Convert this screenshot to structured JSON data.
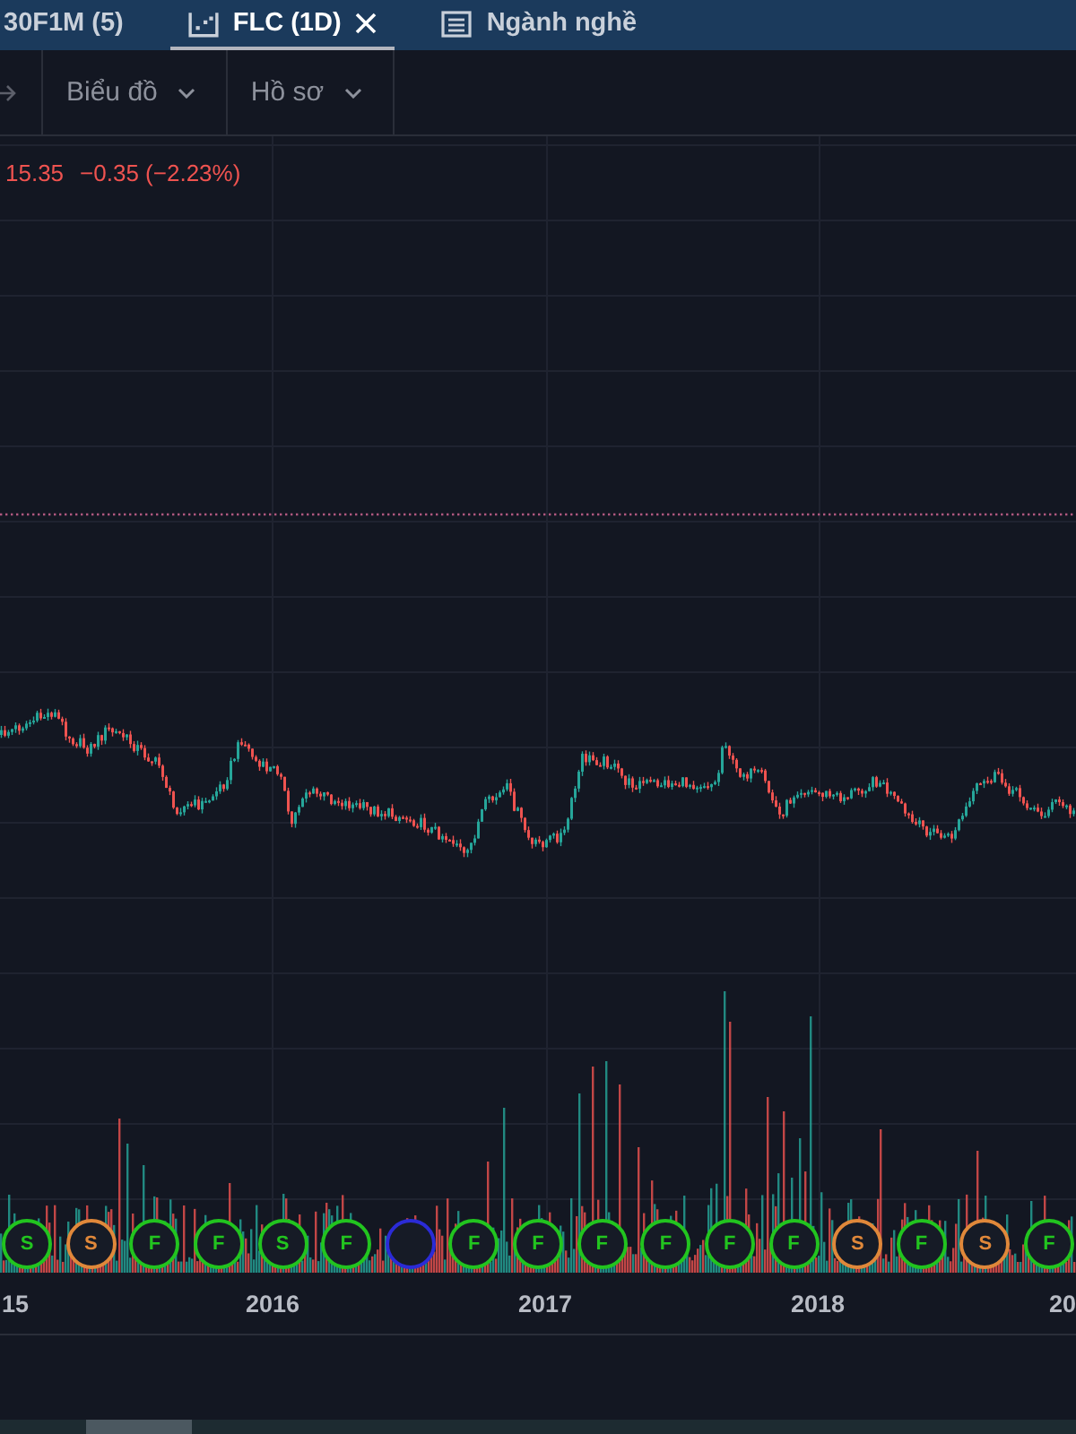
{
  "tabs": [
    {
      "kind": "symbol",
      "label": "30F1M (5)",
      "selected": false
    },
    {
      "kind": "chart",
      "label": "FLC (1D)",
      "selected": true
    },
    {
      "kind": "table",
      "label": "Ngành nghề",
      "selected": false
    }
  ],
  "toolbar": {
    "menus": [
      {
        "label": "Biểu đồ"
      },
      {
        "label": "Hồ sơ"
      }
    ]
  },
  "chart": {
    "legend": {
      "close": "15.35",
      "change": "−0.35 (−2.23%)",
      "negative": true
    },
    "events": [
      {
        "label": "S",
        "color": "#22c41f"
      },
      {
        "label": "S",
        "color": "#e0883a"
      },
      {
        "label": "F",
        "color": "#22c41f"
      },
      {
        "label": "F",
        "color": "#22c41f"
      },
      {
        "label": "S",
        "color": "#22c41f"
      },
      {
        "label": "F",
        "color": "#22c41f"
      },
      {
        "color": "#2b2bd6"
      },
      {
        "label": "F",
        "color": "#22c41f"
      },
      {
        "label": "F",
        "color": "#22c41f"
      },
      {
        "label": "F",
        "color": "#22c41f"
      },
      {
        "label": "F",
        "color": "#22c41f"
      },
      {
        "label": "F",
        "color": "#22c41f"
      },
      {
        "label": "F",
        "color": "#22c41f"
      },
      {
        "label": "S",
        "color": "#e0883a"
      },
      {
        "label": "F",
        "color": "#22c41f"
      },
      {
        "label": "S",
        "color": "#e0883a"
      },
      {
        "label": "F",
        "color": "#22c41f"
      }
    ],
    "time_axis": {
      "labels": [
        "15",
        "2016",
        "2017",
        "2018",
        "20"
      ]
    }
  }
}
